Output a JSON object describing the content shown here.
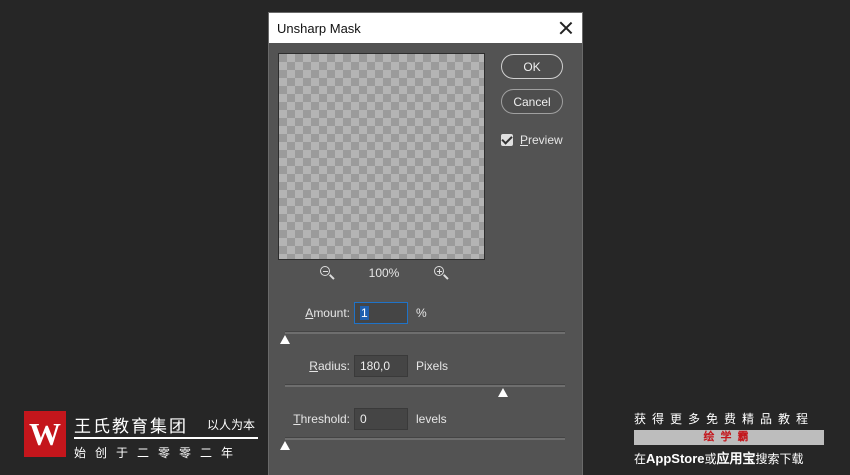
{
  "dialog": {
    "title": "Unsharp Mask",
    "ok_label": "OK",
    "cancel_label": "Cancel",
    "preview_label_u": "P",
    "preview_label_rest": "review",
    "preview_checked": true,
    "zoom_level": "100%",
    "params": [
      {
        "label_u": "A",
        "label_rest": "mount:",
        "value": "1",
        "unit": "%",
        "slider_fraction": 0.0
      },
      {
        "label_u": "R",
        "label_rest": "adius:",
        "value": "180,0",
        "unit": "Pixels",
        "slider_fraction": 0.78
      },
      {
        "label_u": "T",
        "label_rest": "hreshold:",
        "value": "0",
        "unit": "levels",
        "slider_fraction": 0.0
      }
    ]
  },
  "watermark_left": {
    "logo_letter": "W",
    "name": "王氏教育集团",
    "slogan": "以人为本",
    "subtitle": "始创于二零零二年"
  },
  "watermark_right": {
    "top": "获得更多免费精品教程",
    "bar": "绘学霸",
    "bottom_pre": "在",
    "bottom_app": "AppStore",
    "bottom_mid": "或",
    "bottom_store": "应用宝",
    "bottom_post": "搜索下载"
  },
  "colors": {
    "background": "#262626",
    "dialog": "#535353",
    "accent_blue": "#1f73c8",
    "brand_red": "#c4161c"
  }
}
